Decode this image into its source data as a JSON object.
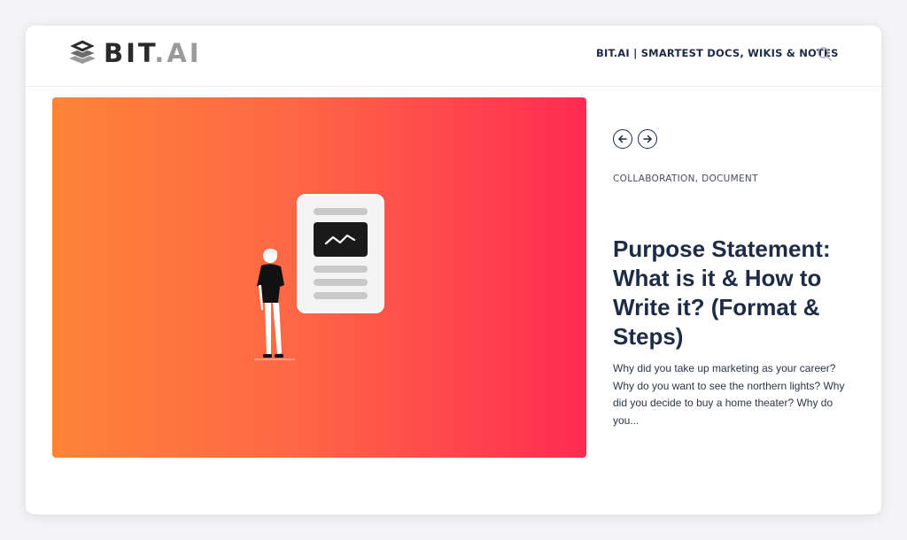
{
  "header": {
    "logo": {
      "prefix": "BIT",
      "dot": ".",
      "suffix": "AI",
      "icon": "layers-logo-icon"
    },
    "nav_link": "BIT.AI | SMARTEST DOCS, WIKIS & NOTES",
    "search_icon": "search-icon"
  },
  "hero": {
    "gradient_start": "#fe8338",
    "gradient_end": "#ff2b52",
    "illustration": "person-with-document-illustration"
  },
  "post": {
    "nav_icons": [
      "arrow-left-icon",
      "arrow-right-icon"
    ],
    "categories": [
      "COLLABORATION",
      "DOCUMENT"
    ],
    "category_separator": ", ",
    "title": "Purpose Statement: What is it & How to Write it? (Format & Steps)",
    "excerpt": "Why did you take up  marketing as your career? Why do you want to see the northern lights? Why did you decide to buy a home theater? Why do you..."
  },
  "colors": {
    "text_dark": "#1d2b46",
    "background": "#f4f4f6"
  }
}
